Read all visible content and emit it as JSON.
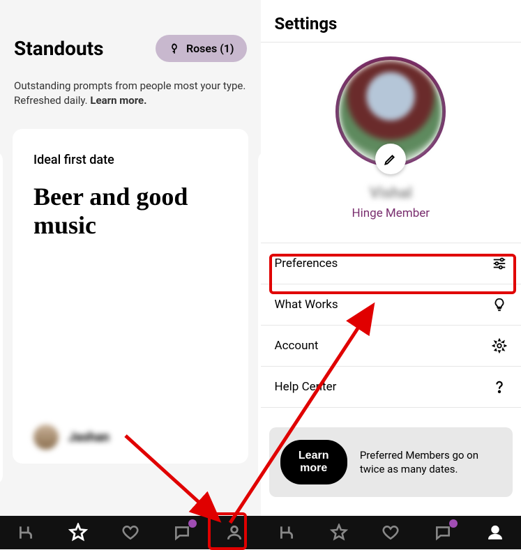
{
  "left": {
    "title": "Standouts",
    "roses_label": "Roses (1)",
    "subtitle_text": "Outstanding prompts from people most your type. Refreshed daily. ",
    "learn_more": "Learn more.",
    "card": {
      "prompt_label": "Ideal first date",
      "answer": "Beer and good music",
      "profile_name": "Jashan"
    }
  },
  "right": {
    "settings_title": "Settings",
    "profile_name": "Vishal",
    "member_label": "Hinge Member",
    "items": [
      {
        "label": "Preferences",
        "icon": "sliders"
      },
      {
        "label": "What Works",
        "icon": "lightbulb"
      },
      {
        "label": "Account",
        "icon": "gear"
      },
      {
        "label": "Help Center",
        "icon": "question"
      }
    ],
    "promo": {
      "button": "Learn more",
      "text": "Preferred Members go on twice as many dates."
    }
  },
  "nav": {
    "items": [
      "hinge",
      "star",
      "heart",
      "chat",
      "profile"
    ]
  }
}
